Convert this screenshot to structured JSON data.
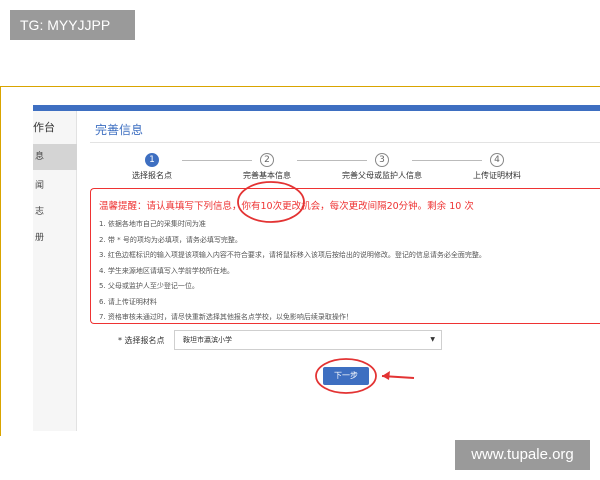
{
  "watermark_top": "TG: MYYJJPP",
  "watermark_bottom": "www.tupale.org",
  "colors": {
    "primary": "#3e6fc1",
    "alert": "#e33333",
    "frame": "#d9a400"
  },
  "sidebar": {
    "header": "作台",
    "items": [
      {
        "label": "息",
        "active": true
      },
      {
        "label": "闻",
        "active": false
      },
      {
        "label": "志",
        "active": false
      },
      {
        "label": "册",
        "active": false
      }
    ]
  },
  "main": {
    "title": "完善信息",
    "steps": [
      {
        "number": "1",
        "label": "选择报名点",
        "active": true
      },
      {
        "number": "2",
        "label": "完善基本信息",
        "active": false
      },
      {
        "number": "3",
        "label": "完善父母或监护人信息",
        "active": false
      },
      {
        "number": "4",
        "label": "上传证明材料",
        "active": false
      }
    ],
    "notice": {
      "heading": "温馨提醒：请认真填写下列信息，你有10次更改机会，每次更改间隔20分钟。剩余 10 次",
      "items": [
        "1. 依据各地市自己的采集时间为准",
        "2. 带 * 号的项均为必填项，请务必填写完整。",
        "3. 红色边框标识的输入项提该项输入内容不符合要求，请将鼠标移入该项后按给出的说明修改。登记的信息请务必全面完整。",
        "4. 学生来源地区请填写入学前学校所在地。",
        "5. 父母或监护人至少登记一位。",
        "6. 请上传证明材料",
        "7. 资格审核未通过时，请尽快重新选择其他报名点学校，以免影响后续录取操作！"
      ]
    },
    "form": {
      "label": "* 选择报名点",
      "selected": "鞍坦市瀛滨小学",
      "caret": "▼"
    },
    "next_button": "下一步"
  }
}
